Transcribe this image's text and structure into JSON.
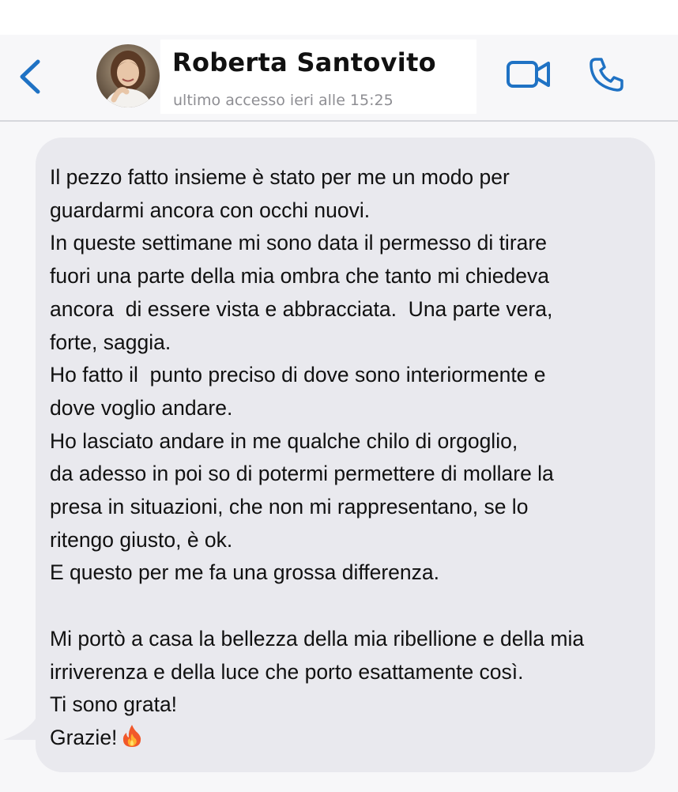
{
  "header": {
    "contact_name": "Roberta Santovito",
    "last_seen": "ultimo accesso ieri alle 15:25",
    "icons": {
      "back": "chevron-left-icon",
      "video": "video-camera-icon",
      "call": "phone-icon"
    }
  },
  "message": {
    "text": "Il pezzo fatto insieme è stato per me un modo per\nguardarmi ancora con occhi nuovi.\nIn queste settimane mi sono data il permesso di tirare\nfuori una parte della mia ombra che tanto mi chiedeva\nancora  di essere vista e abbracciata.  Una parte vera,\nforte, saggia.\nHo fatto il  punto preciso di dove sono interiormente e\ndove voglio andare.\nHo lasciato andare in me qualche chilo di orgoglio,\nda adesso in poi so di potermi permettere di mollare la\npresa in situazioni, che non mi rappresentano, se lo\nritengo giusto, è ok.\nE questo per me fa una grossa differenza.\n\nMi portò a casa la bellezza della mia ribellione e della mia\nirriverenza e della luce che porto esattamente così.\nTi sono grata!\nGrazie!",
    "trailing_emoji": "fire-emoji"
  },
  "colors": {
    "accent": "#1f72c4",
    "bubble": "#e9e9ee",
    "header_background": "#f7f7f9",
    "secondary_text": "#8e8e93"
  }
}
